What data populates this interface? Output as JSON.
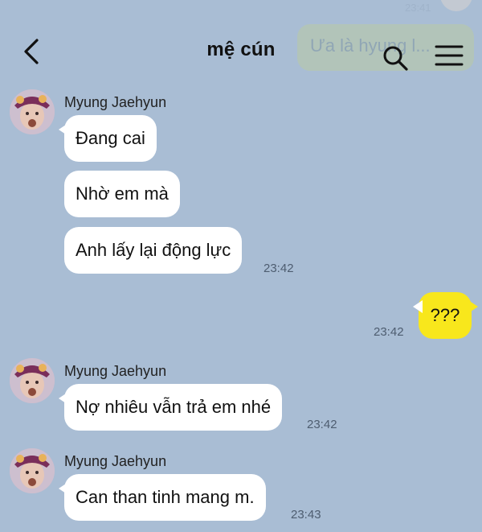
{
  "header": {
    "title": "mệ cún"
  },
  "background_preview": {
    "text": "Ưa là hyung l...",
    "time": "23:41"
  },
  "messages": [
    {
      "sender": "Myung Jaehyun",
      "text": "Đang cai"
    },
    {
      "text": "Nhờ em mà"
    },
    {
      "text": "Anh lấy lại động lực",
      "time": "23:42"
    },
    {
      "text": "???",
      "time": "23:42",
      "outgoing": true
    },
    {
      "sender": "Myung Jaehyun",
      "text": "Nợ nhiêu vẫn trả em nhé",
      "time": "23:42"
    },
    {
      "sender": "Myung Jaehyun",
      "text": "Can than tinh mang m.",
      "time": "23:43"
    }
  ],
  "colors": {
    "background": "#a9bdd4",
    "incoming_bubble": "#ffffff",
    "outgoing_bubble": "#f8e71c"
  }
}
